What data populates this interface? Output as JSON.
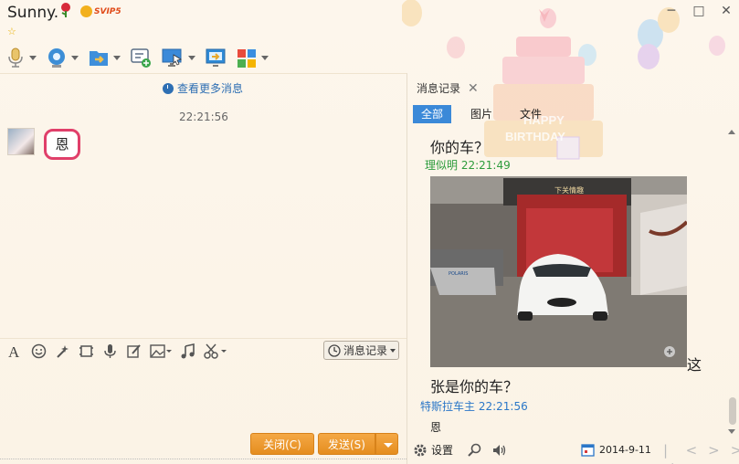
{
  "window": {
    "title": "Sunny.",
    "vip_badge": "SVIP5",
    "star_glyph": "☆",
    "controls": [
      "minimize-icon",
      "maximize-icon",
      "close-icon"
    ]
  },
  "toolbar": {
    "items": [
      "microphone-icon",
      "video-camera-icon",
      "file-transfer-icon",
      "add-message-icon",
      "remote-desktop-icon",
      "screen-share-icon",
      "apps-icon"
    ]
  },
  "chat": {
    "more_history": "查看更多消息",
    "message_time": "22:21:56",
    "message_text": "恩"
  },
  "input_toolbar": {
    "items": [
      "font-icon",
      "emoji-icon",
      "magic-icon",
      "screenshot-frame-icon",
      "voice-icon",
      "edit-icon",
      "image-icon",
      "music-icon",
      "scissors-icon"
    ],
    "history_button": "消息记录"
  },
  "buttons": {
    "close": "关闭(C)",
    "send": "发送(S)"
  },
  "history_panel": {
    "tab_label": "消息记录",
    "filter_tabs": [
      "全部",
      "图片",
      "文件"
    ],
    "active_filter": "全部",
    "entries": {
      "line1": "你的车？",
      "sender1": "理似明",
      "time1": "22:21:49",
      "after_image_suffix": "这",
      "line2": "张是你的车？",
      "sender2": "特斯拉车主",
      "time2": "22:21:56",
      "line3": "恩"
    },
    "photo_sign": "下关情趣",
    "settings_label": "设置",
    "date": "2014-9-11",
    "birthday_text_1": "HAPPY",
    "birthday_text_2": "BIRTHDAY"
  },
  "colors": {
    "accent_blue": "#3b89d8",
    "send_orange": "#e58d1f",
    "sender_green": "#2d9c3c",
    "sender_blue": "#2b77c8",
    "bubble_border": "#e03f6a"
  }
}
